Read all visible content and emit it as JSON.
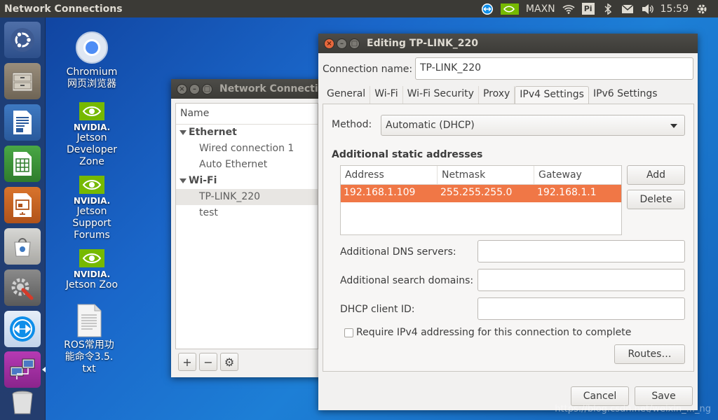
{
  "panel": {
    "title": "Network Connections",
    "tray": {
      "nvidia_label": "MAXN",
      "clock": "15:59",
      "pi_label": "Pi"
    }
  },
  "launcher": {
    "items": [
      "ubuntu-dash",
      "files",
      "writer",
      "calc",
      "impress",
      "software-center",
      "system-settings",
      "teamviewer",
      "network-connections",
      "trash"
    ]
  },
  "desktop": {
    "icons": [
      {
        "label": "Chromium\n网页浏览器"
      },
      {
        "label": "Jetson\nDeveloper\nZone",
        "brand": "NVIDIA."
      },
      {
        "label": "Jetson\nSupport\nForums",
        "brand": "NVIDIA."
      },
      {
        "label": "Jetson Zoo",
        "brand": "NVIDIA."
      },
      {
        "label": "ROS常用功\n能命令3.5.\ntxt"
      }
    ]
  },
  "back_window": {
    "title": "Network Connections",
    "column": "Name",
    "groups": [
      {
        "name": "Ethernet",
        "items": [
          "Wired connection 1",
          "Auto Ethernet"
        ]
      },
      {
        "name": "Wi-Fi",
        "items": [
          "TP-LINK_220",
          "test"
        ]
      }
    ],
    "selected": "TP-LINK_220"
  },
  "dialog": {
    "title": "Editing TP-LINK_220",
    "connection_name_label": "Connection name:",
    "connection_name_value": "TP-LINK_220",
    "tabs": [
      "General",
      "Wi-Fi",
      "Wi-Fi Security",
      "Proxy",
      "IPv4 Settings",
      "IPv6 Settings"
    ],
    "active_tab": "IPv4 Settings",
    "method_label": "Method:",
    "method_value": "Automatic (DHCP)",
    "static_heading": "Additional static addresses",
    "table": {
      "columns": [
        "Address",
        "Netmask",
        "Gateway"
      ],
      "rows": [
        [
          "192.168.1.109",
          "255.255.255.0",
          "192.168.1.1"
        ]
      ]
    },
    "add_button": "Add",
    "delete_button": "Delete",
    "dns_label": "Additional DNS servers:",
    "search_label": "Additional search domains:",
    "dhcp_label": "DHCP client ID:",
    "require_label": "Require IPv4 addressing for this connection to complete",
    "require_checked": false,
    "routes_button": "Routes…",
    "cancel_button": "Cancel",
    "save_button": "Save"
  },
  "watermark": "https://blog.csdn.net/weixin_..._ng",
  "colors": {
    "accent": "#f07746",
    "panel": "#3b3a36",
    "desktop": "#1a66c9"
  }
}
